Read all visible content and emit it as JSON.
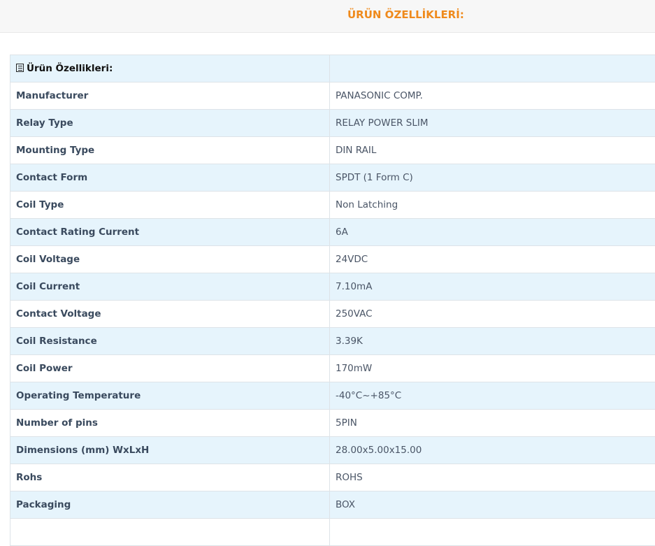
{
  "header": {
    "section_title": "ÜRÜN ÖZELLİKLERİ:"
  },
  "table": {
    "header_label": "Ürün Özellikleri:",
    "header_value": "",
    "rows": [
      {
        "label": "Manufacturer",
        "value": "PANASONIC COMP."
      },
      {
        "label": "Relay Type",
        "value": "RELAY POWER SLIM"
      },
      {
        "label": "Mounting Type",
        "value": "DIN RAIL"
      },
      {
        "label": "Contact Form",
        "value": "SPDT (1 Form C)"
      },
      {
        "label": "Coil Type",
        "value": "Non Latching"
      },
      {
        "label": "Contact Rating Current",
        "value": "6A"
      },
      {
        "label": "Coil Voltage",
        "value": "24VDC"
      },
      {
        "label": "Coil Current",
        "value": "7.10mA"
      },
      {
        "label": "Contact Voltage",
        "value": "250VAC"
      },
      {
        "label": "Coil Resistance",
        "value": "3.39K"
      },
      {
        "label": "Coil Power",
        "value": "170mW"
      },
      {
        "label": "Operating Temperature",
        "value": "-40°C~+85°C"
      },
      {
        "label": "Number of pins",
        "value": "5PIN"
      },
      {
        "label": "Dimensions (mm) WxLxH",
        "value": "28.00x5.00x15.00"
      },
      {
        "label": "Rohs",
        "value": "ROHS"
      },
      {
        "label": "Packaging",
        "value": "BOX"
      },
      {
        "label": "",
        "value": ""
      }
    ]
  },
  "icons": {
    "header_icon": "list-icon"
  }
}
